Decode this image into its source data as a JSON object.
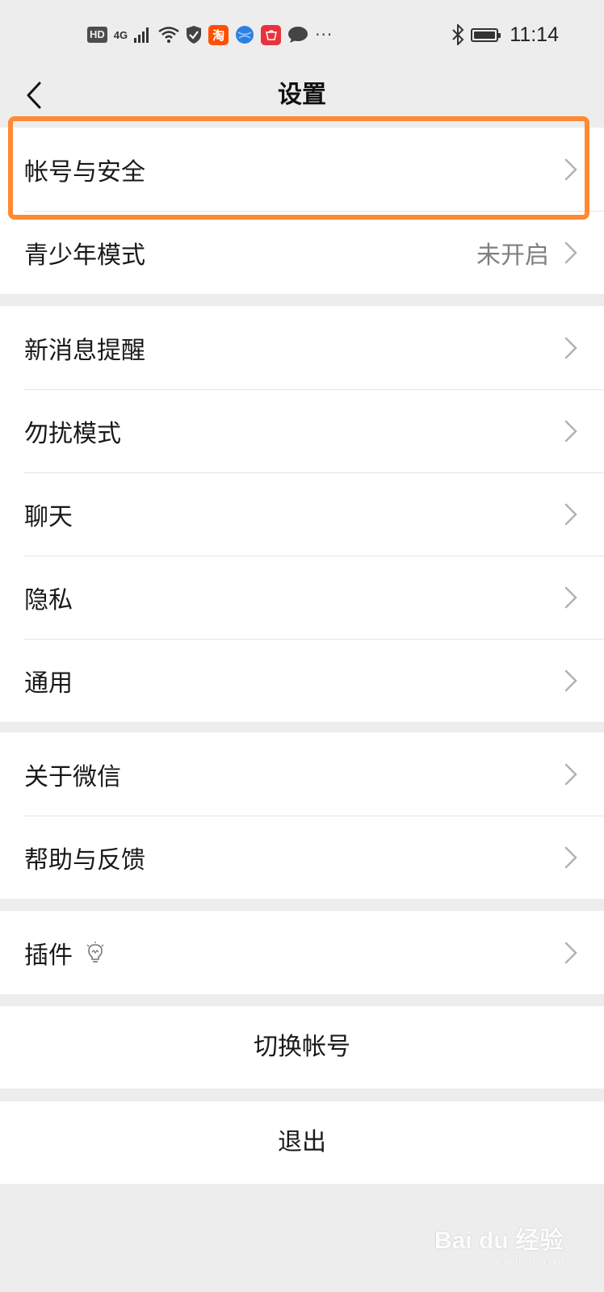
{
  "status_bar": {
    "hd": "HD",
    "network": "4G",
    "taobao_glyph": "淘",
    "more": "···",
    "time": "11:14",
    "icons": [
      "signal-icon",
      "wifi-icon",
      "shield-icon",
      "taobao-app-icon",
      "browser-app-icon",
      "huawei-app-icon",
      "message-icon",
      "bluetooth-icon",
      "battery-icon"
    ]
  },
  "nav": {
    "title": "设置",
    "back_icon": "chevron-left-icon"
  },
  "groups": [
    {
      "items": [
        {
          "label": "帐号与安全",
          "value": ""
        },
        {
          "label": "青少年模式",
          "value": "未开启"
        }
      ]
    },
    {
      "items": [
        {
          "label": "新消息提醒",
          "value": ""
        },
        {
          "label": "勿扰模式",
          "value": ""
        },
        {
          "label": "聊天",
          "value": ""
        },
        {
          "label": "隐私",
          "value": ""
        },
        {
          "label": "通用",
          "value": ""
        }
      ]
    },
    {
      "items": [
        {
          "label": "关于微信",
          "value": ""
        },
        {
          "label": "帮助与反馈",
          "value": ""
        }
      ]
    },
    {
      "items": [
        {
          "label": "插件",
          "value": "",
          "icon": "lightbulb-icon"
        }
      ]
    }
  ],
  "actions": {
    "switch_account": "切换帐号",
    "logout": "退出"
  },
  "highlight_color": "#ff8a33",
  "watermark": {
    "main": "Bai du 经验",
    "sub": "jingyan.baidu.com"
  }
}
